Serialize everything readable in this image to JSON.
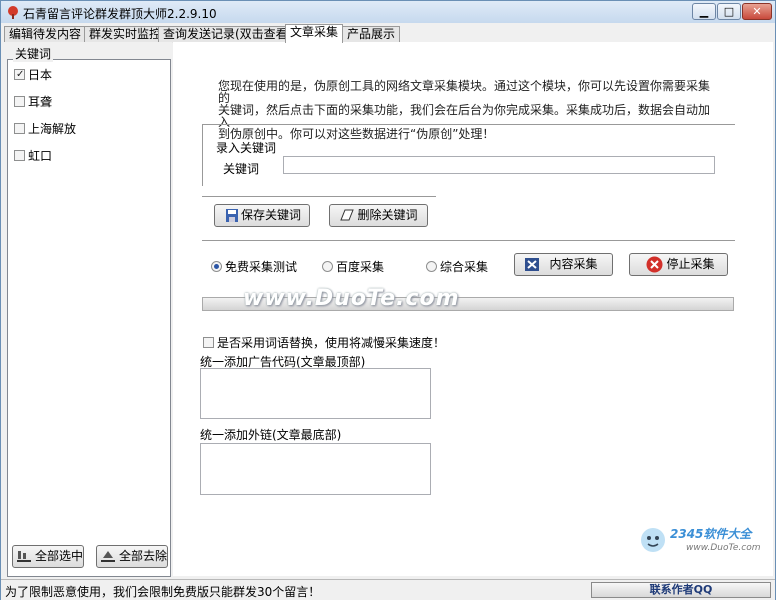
{
  "window": {
    "title": "石青留言评论群发群顶大师2.2.9.10"
  },
  "tabs": [
    {
      "label": "编辑待发内容",
      "active": false
    },
    {
      "label": "群发实时监控",
      "active": false
    },
    {
      "label": "查询发送记录(双击查看)",
      "active": false
    },
    {
      "label": "文章采集",
      "active": true
    },
    {
      "label": "产品展示",
      "active": false
    }
  ],
  "keywords": {
    "group_label": "关键词",
    "items": [
      {
        "label": "日本",
        "checked": true
      },
      {
        "label": "耳聋",
        "checked": false
      },
      {
        "label": "上海解放",
        "checked": false
      },
      {
        "label": "虹口",
        "checked": false
      }
    ],
    "select_all_label": "全部选中",
    "deselect_all_label": "全部去除"
  },
  "main": {
    "intro_lines": [
      "您现在使用的是，伪原创工具的网络文章采集模块。通过这个模块，你可以先设置你需要采集的",
      "关键词，然后点击下面的采集功能，我们会在后台为你完成采集。采集成功后，数据会自动加入",
      "到伪原创中。你可以对这些数据进行“伪原创”处理！"
    ],
    "keyword_section_label": "录入关键词",
    "keyword_field_label": "关键词",
    "keyword_field_value": "",
    "save_keyword_label": "保存关键词",
    "delete_keyword_label": "删除关键词",
    "modes": [
      {
        "label": "免费采集测试",
        "selected": true
      },
      {
        "label": "百度采集",
        "selected": false
      },
      {
        "label": "综合采集",
        "selected": false
      }
    ],
    "content_collect_label": "内容采集",
    "stop_collect_label": "停止采集",
    "progress": 0,
    "watermark": "www.DuoTe.com",
    "replace_words_label": "是否采用词语替换，使用将减慢采集速度！",
    "replace_words_checked": false,
    "ad_code_label": "统一添加广告代码(文章最顶部)",
    "ad_code_value": "",
    "external_link_label": "统一添加外链(文章最底部)",
    "external_link_value": ""
  },
  "corner_logo": {
    "name": "2345软件大全",
    "url": "www.DuoTe.com"
  },
  "status": {
    "message": "为了限制恶意使用，我们会限制免费版只能群发30个留言！",
    "contact_label": "联系作者QQ"
  },
  "colors": {
    "title_bar": "#c6d9ee",
    "close_button": "#c8493b",
    "radio_dot": "#2b55a5",
    "stop_icon": "#d2302a"
  }
}
